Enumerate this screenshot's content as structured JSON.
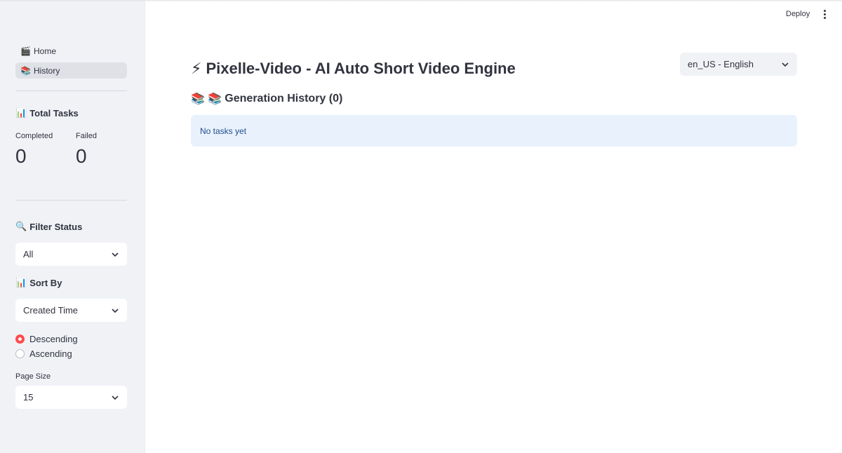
{
  "toolbar": {
    "deploy_label": "Deploy"
  },
  "sidebar": {
    "nav": [
      {
        "label": "Home",
        "icon": "clapper-icon",
        "emoji": "🎬",
        "active": false
      },
      {
        "label": "History",
        "icon": "books-icon",
        "emoji": "📚",
        "active": true
      }
    ],
    "stats": {
      "heading": "Total Tasks",
      "heading_emoji": "📊",
      "completed_label": "Completed",
      "completed_value": "0",
      "failed_label": "Failed",
      "failed_value": "0"
    },
    "filter": {
      "heading": "Filter Status",
      "heading_emoji": "🔍",
      "selected": "All"
    },
    "sort": {
      "heading": "Sort By",
      "heading_emoji": "📊",
      "selected": "Created Time",
      "order_options": [
        {
          "label": "Descending",
          "checked": true
        },
        {
          "label": "Ascending",
          "checked": false
        }
      ]
    },
    "page_size": {
      "label": "Page Size",
      "selected": "15"
    }
  },
  "main": {
    "title": "Pixelle-Video - AI Auto Short Video Engine",
    "title_emoji": "⚡",
    "language": {
      "selected": "en_US - English"
    },
    "history_heading": "Generation History (0)",
    "history_emoji": "📚 📚",
    "empty_message": "No tasks yet"
  },
  "colors": {
    "sidebar_bg": "#f0f2f6",
    "accent": "#ff4b4b",
    "info_bg": "#e9f1fd",
    "info_text": "#1e4f8c"
  }
}
